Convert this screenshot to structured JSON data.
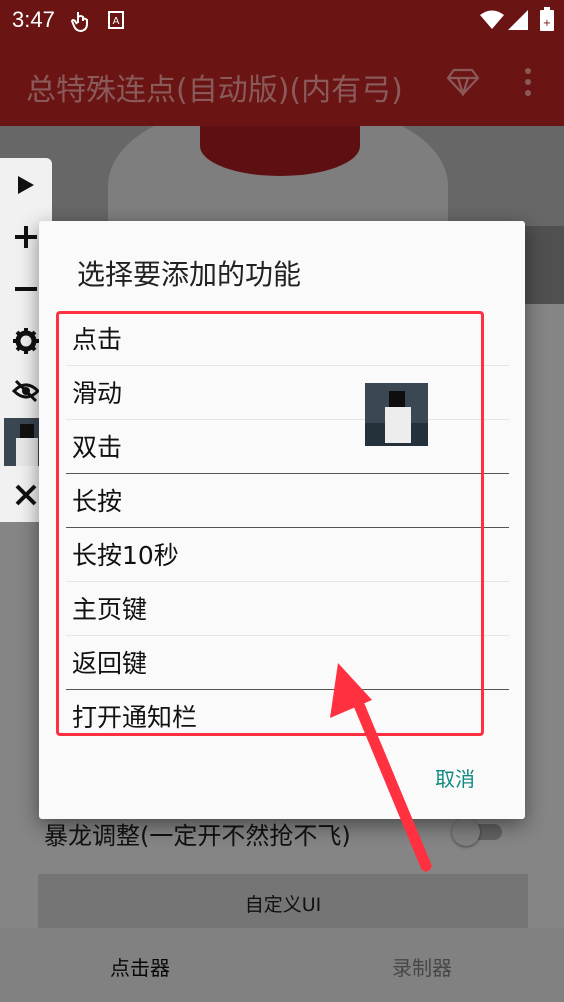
{
  "status_bar": {
    "time": "3:47",
    "icons": [
      "touch-icon",
      "font-icon",
      "wifi-icon",
      "signal-icon",
      "battery-icon"
    ]
  },
  "app_bar": {
    "title": "总特殊连点(自动版)(内有弓)",
    "actions": [
      "diamond-icon",
      "more-vert-icon"
    ]
  },
  "floating_toolbar": {
    "items": [
      "play-icon",
      "plus-icon",
      "minus-icon",
      "gear-icon",
      "eye-off-icon",
      "thumbnail",
      "close-icon"
    ]
  },
  "dialog": {
    "title": "选择要添加的功能",
    "options": [
      "点击",
      "滑动",
      "双击",
      "长按",
      "长按10秒",
      "主页键",
      "返回键",
      "打开通知栏"
    ],
    "cancel": "取消"
  },
  "background": {
    "switch_label": "暴龙调整(一定开不然抢不飞)",
    "switch_on": false,
    "custom_button": "自定义UI"
  },
  "bottom_nav": {
    "tabs": [
      "点击器",
      "录制器"
    ],
    "active": 0
  },
  "colors": {
    "app_bar": "#6b1414",
    "accent": "#0f8a80",
    "annotation": "#ff3040"
  }
}
